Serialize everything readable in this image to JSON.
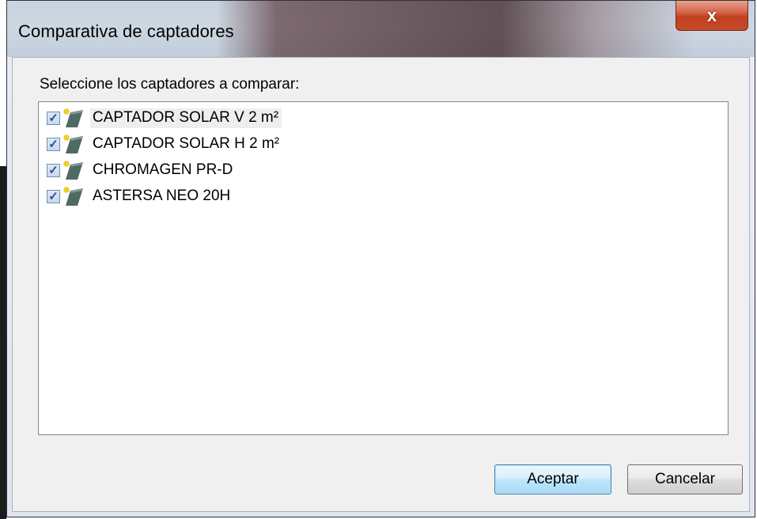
{
  "window": {
    "title": "Comparativa de captadores",
    "close_glyph": "x"
  },
  "prompt": "Seleccione los captadores a comparar:",
  "collectors": [
    {
      "label": "CAPTADOR SOLAR V 2 m²",
      "checked": true,
      "icon": "solar-panel-icon"
    },
    {
      "label": "CAPTADOR SOLAR H 2 m²",
      "checked": true,
      "icon": "solar-panel-icon"
    },
    {
      "label": "CHROMAGEN PR-D",
      "checked": true,
      "icon": "solar-panel-icon"
    },
    {
      "label": "ASTERSA NEO 20H",
      "checked": true,
      "icon": "solar-panel-icon"
    }
  ],
  "check_glyph": "✓",
  "buttons": {
    "accept": "Aceptar",
    "cancel": "Cancelar"
  },
  "colors": {
    "close_button": "#c0401f",
    "accept_border": "#3c7fb1",
    "panel": "#4d6b63",
    "sun": "#f5d21e"
  }
}
